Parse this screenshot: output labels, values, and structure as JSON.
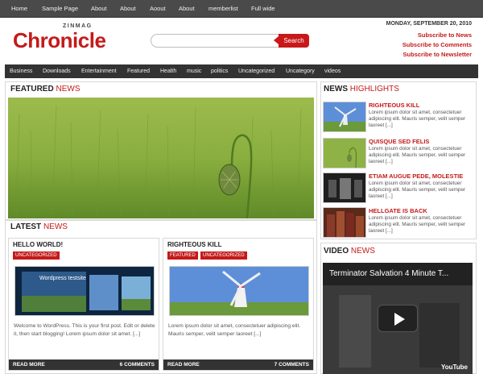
{
  "topnav": {
    "items": [
      "Home",
      "Sample Page",
      "About",
      "About",
      "Aoout",
      "About",
      "memberlist",
      "Full wide"
    ]
  },
  "header": {
    "logo_small": "ZINMAG",
    "logo_big_first": "Chr",
    "logo_big_rest": "onicle",
    "search_placeholder": "",
    "search_button": "Search",
    "date": "MONDAY, SEPTEMBER 20, 2010",
    "subscribe_news": "Subscribe to News",
    "subscribe_comments": "Subscribe to Comments",
    "subscribe_newsletter": "Subscribe to Newsletter"
  },
  "catbar": {
    "items": [
      "Business",
      "Downloads",
      "Entertainment",
      "Featured",
      "Health",
      "music",
      "politics",
      "Uncategorized",
      "Uncategory",
      "videos"
    ]
  },
  "featured": {
    "title_black": "FEATURED",
    "title_red": "NEWS"
  },
  "highlights": {
    "title_black": "NEWS",
    "title_red": "HIGHLIGHTS",
    "items": [
      {
        "title": "RIGHTEOUS KILL",
        "text": "Lorem ipsum dolor sit amet, consectetuer adipiscing elit. Mauris semper, velit semper laoreet [...]"
      },
      {
        "title": "QUISQUE SED FELIS",
        "text": "Lorem ipsum dolor sit amet, consectetuer adipiscing elit. Mauris semper, velit semper laoreet [...]"
      },
      {
        "title": "ETIAM AUGUE PEDE, MOLESTIE",
        "text": "Lorem ipsum dolor sit amet, consectetuer adipiscing elit. Mauris semper, velit semper laoreet [...]"
      },
      {
        "title": "HELLGATE IS BACK",
        "text": "Lorem ipsum dolor sit amet, consectetuer adipiscing elit. Mauris semper, velit semper laoreet [...]"
      }
    ]
  },
  "latest": {
    "title_black": "LATEST",
    "title_red": "NEWS",
    "posts": [
      {
        "title": "HELLO WORLD!",
        "tags": [
          "UNCATEGORIZED"
        ],
        "image_caption": "Wordpress testsite",
        "text": "Welcome to WordPress. This is your first post. Edit or delete it, then start blogging! Lorem ipsum dolor sit amet. [...]",
        "read_more": "READ MORE",
        "comments": "6 COMMENTS"
      },
      {
        "title": "RIGHTEOUS KILL",
        "tags": [
          "FEATURED",
          "UNCATEGORIZED"
        ],
        "text": "Lorem ipsum dolor sit amet, consectetuer adipiscing elit. Mauris semper, velit semper laoreet [...]",
        "read_more": "READ MORE",
        "comments": "7 COMMENTS"
      }
    ]
  },
  "video": {
    "title_black": "VIDEO",
    "title_red": "NEWS",
    "player_title": "Terminator Salvation 4 Minute T...",
    "brand": "YouTube"
  },
  "colors": {
    "accent": "#c41a1a",
    "nav_bg": "#4a4a4a",
    "bar_bg": "#333333"
  }
}
